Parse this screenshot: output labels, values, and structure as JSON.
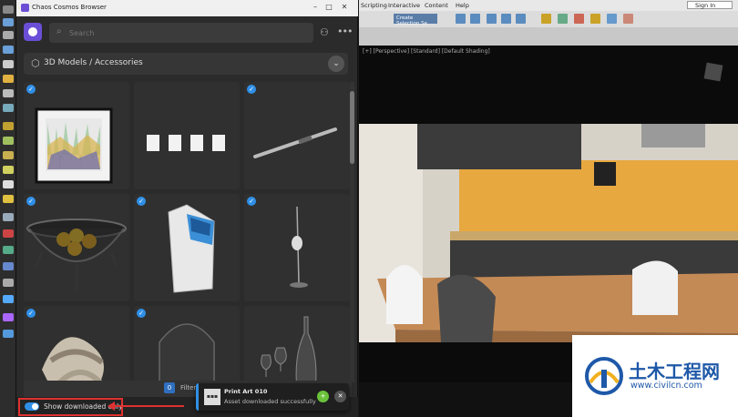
{
  "browser": {
    "title": "Chaos Cosmos Browser",
    "search_placeholder": "Search",
    "category_title": "3D Models / Accessories",
    "filter_count": "0",
    "filter_label": "Filters",
    "show_downloaded_label": "Show downloaded only",
    "show_downloaded_on": true
  },
  "toast": {
    "title": "Print Art 010",
    "message": "Asset downloaded successfully",
    "accent": "#2f8fe6"
  },
  "max": {
    "menu": [
      "Scripting",
      "Interactive",
      "Content",
      "Help"
    ],
    "sign_in": "Sign In",
    "selection_set": "Create Selection Se",
    "viewport_label": "[+] [Perspective] [Standard] [Default Shading]"
  },
  "watermark": {
    "cn": "土木工程网",
    "url": "www.civilcn.com"
  },
  "colors": {
    "accent": "#2f8fe6",
    "brand": "#6a4fd6",
    "highlight": "#e03030"
  }
}
